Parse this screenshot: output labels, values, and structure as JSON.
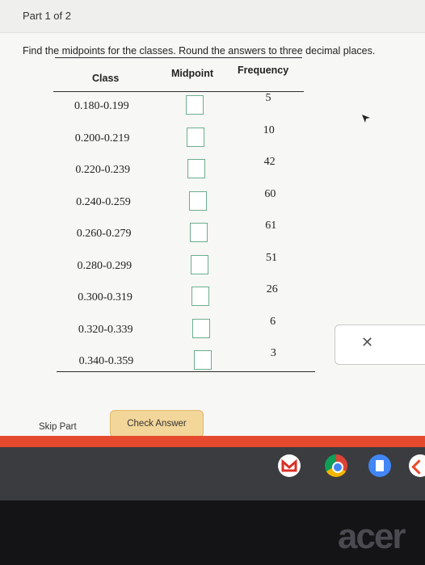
{
  "part_label": "Part 1 of 2",
  "instructions": "Find the midpoints for the classes. Round the answers to three decimal places.",
  "table": {
    "headers": {
      "class": "Class",
      "midpoint": "Midpoint",
      "frequency": "Frequency"
    },
    "rows": [
      {
        "class": "0.180-0.199",
        "frequency": "5",
        "midpoint": ""
      },
      {
        "class": "0.200-0.219",
        "frequency": "10",
        "midpoint": ""
      },
      {
        "class": "0.220-0.239",
        "frequency": "42",
        "midpoint": ""
      },
      {
        "class": "0.240-0.259",
        "frequency": "60",
        "midpoint": ""
      },
      {
        "class": "0.260-0.279",
        "frequency": "61",
        "midpoint": ""
      },
      {
        "class": "0.280-0.299",
        "frequency": "51",
        "midpoint": ""
      },
      {
        "class": "0.300-0.319",
        "frequency": "26",
        "midpoint": ""
      },
      {
        "class": "0.320-0.339",
        "frequency": "6",
        "midpoint": ""
      },
      {
        "class": "0.340-0.359",
        "frequency": "3",
        "midpoint": ""
      }
    ]
  },
  "buttons": {
    "skip": "Skip Part",
    "check": "Check Answer"
  },
  "close_symbol": "✕",
  "brand": "acer",
  "colors": {
    "box_border": "#6cae8e",
    "check_button": "#f3d69a",
    "red_bar": "#e64a2e"
  },
  "taskbar_icons": [
    "gmail-icon",
    "chrome-icon",
    "docs-icon",
    "app-icon"
  ]
}
